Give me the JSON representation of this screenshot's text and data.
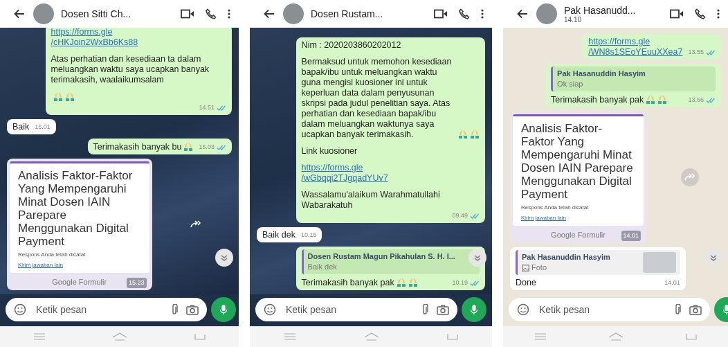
{
  "phones": [
    {
      "header": {
        "name": "Dosen Sitti Ch..."
      },
      "wallpaper_dark": true,
      "messages": [
        {
          "kind": "text",
          "sent": true,
          "blocks": [
            {
              "kind": "link",
              "text": "https://forms.gle\n/cHKJoin2WxBb6Ks88"
            },
            {
              "kind": "text",
              "text": "Atas perhatian dan kesediaan ta dalam meluangkan waktu saya ucapkan banyak terimakasih, waalaikumsalam"
            },
            {
              "kind": "emoji",
              "emojis": [
                {
                  "kind": "pray"
                },
                {
                  "kind": "pray"
                }
              ]
            }
          ],
          "time": "14.51"
        },
        {
          "kind": "text",
          "sent": false,
          "blocks": [
            {
              "kind": "text",
              "text": "Baik"
            }
          ],
          "time": "15.01"
        },
        {
          "kind": "text",
          "sent": true,
          "blocks": [
            {
              "kind": "text",
              "text": "Terimakasih banyak bu",
              "emojis": [
                {
                  "kind": "pray"
                }
              ]
            }
          ],
          "time": "15.03"
        },
        {
          "kind": "form",
          "sent": false,
          "title": "Analisis Faktor-Faktor Yang Mempengaruhi Minat Dosen IAIN Parepare Menggunakan Digital Payment",
          "note": "Respons Anda telah dicatat",
          "link": "Kirim jawaban lain",
          "footer": "Google Formulir",
          "time": "15.23"
        }
      ],
      "input": {
        "placeholder": "Ketik pesan"
      }
    },
    {
      "header": {
        "name": "Dosen Rustam..."
      },
      "wallpaper_dark": true,
      "messages": [
        {
          "kind": "text",
          "sent": true,
          "blocks": [
            {
              "kind": "text",
              "text": "Nim : 2020203860202012"
            },
            {
              "kind": "text",
              "text": "Bermaksud untuk memohon kesediaan bapak/ibu untuk meluangkan waktu guna mengisi kuosioner ini untuk keperluan data dalam penyusunan skripsi pada judul penelitian saya. Atas perhatian dan kesediaan bapak/ibu dalam meluangkan waktunya saya ucapkan banyak terimakasih.",
              "emojis": [
                {
                  "kind": "pray"
                },
                {
                  "kind": "pray"
                }
              ]
            },
            {
              "kind": "text",
              "text": "Link kuosioner"
            },
            {
              "kind": "link",
              "text": "https://forms.gle\n/wGbqqi2TJgqadYUv7"
            },
            {
              "kind": "text",
              "text": "Wassalamu'alaikum Warahmatullahi Wabarakatuh"
            }
          ],
          "time": "09.49"
        },
        {
          "kind": "text",
          "sent": false,
          "blocks": [
            {
              "kind": "text",
              "text": "Baik dek"
            }
          ],
          "time": "10.15"
        },
        {
          "kind": "text",
          "sent": true,
          "quote": {
            "name": "Dosen Rustam Magun Pikahulan S. H. I...",
            "text": "Baik dek"
          },
          "blocks": [
            {
              "kind": "text",
              "text": "Terimakasih banyak pak",
              "emojis": [
                {
                  "kind": "pray"
                },
                {
                  "kind": "pray"
                }
              ]
            }
          ],
          "time": "10.19"
        }
      ],
      "input": {
        "placeholder": "Ketik pesan"
      }
    },
    {
      "header": {
        "name": "Pak Hasanudd...",
        "subtitle": "14.10"
      },
      "wallpaper_dark": false,
      "messages": [
        {
          "kind": "text",
          "sent": true,
          "blocks": [
            {
              "kind": "link",
              "text": "https://forms.gle\n/WN8s1SEoYEuuXXea7"
            }
          ],
          "time": "13.55"
        },
        {
          "kind": "text",
          "sent": true,
          "quote": {
            "name": "Pak Hasanuddin Hasyim",
            "text": "Ok siap"
          },
          "blocks": [
            {
              "kind": "text",
              "text": "Terimakasih banyak pak",
              "emojis": [
                {
                  "kind": "pray"
                },
                {
                  "kind": "pray"
                }
              ]
            }
          ],
          "time": "13.56"
        },
        {
          "kind": "form",
          "sent": false,
          "title": "Analisis Faktor-Faktor Yang Mempengaruhi Minat Dosen IAIN Parepare Menggunakan Digital Payment",
          "note": "Respons Anda telah dicatat",
          "link": "Kirim jawaban lain",
          "footer": "Google Formulir",
          "time": "14.01"
        },
        {
          "kind": "text",
          "sent": false,
          "quote": {
            "name": "Pak Hasanuddin Hasyim",
            "text": "Foto",
            "has_photo": true
          },
          "blocks": [
            {
              "kind": "text",
              "text": "Done"
            }
          ],
          "time": "14.01"
        }
      ],
      "input": {
        "placeholder": "Ketik pesan"
      }
    }
  ]
}
